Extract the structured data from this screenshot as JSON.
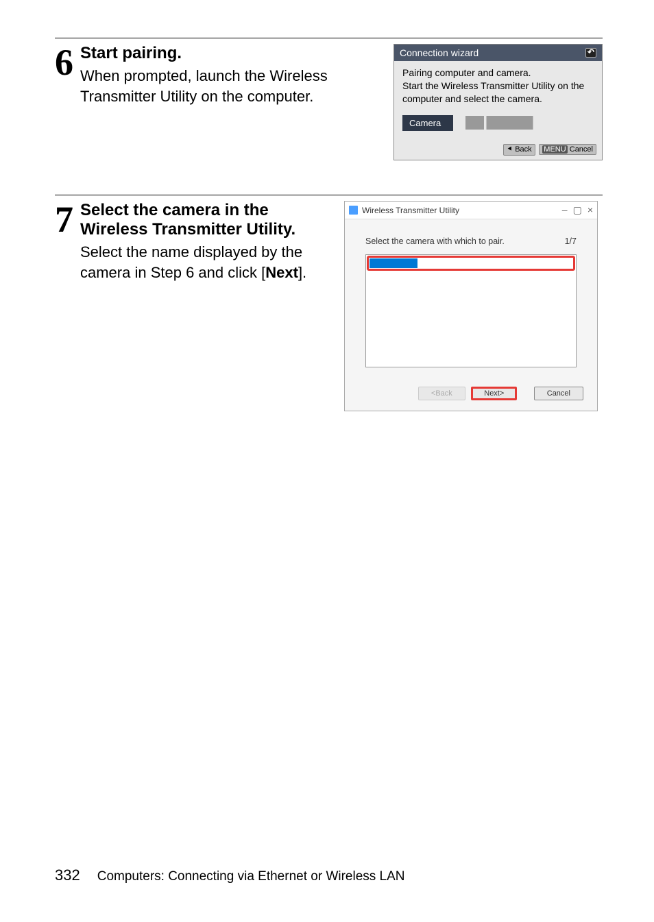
{
  "step6": {
    "number": "6",
    "title": "Start pairing.",
    "text": "When prompted, launch the Wireless Transmitter Utility on the computer."
  },
  "camera": {
    "header": "Connection wizard",
    "body_line1": "Pairing computer and camera.",
    "body_line2": "Start the Wireless Transmitter Utility on the computer and select the camera.",
    "camera_label": "Camera",
    "back_btn": "Back",
    "menu_btn": "MENU",
    "cancel_btn": "Cancel"
  },
  "step7": {
    "number": "7",
    "title": "Select the camera in the Wireless Transmitter Utility.",
    "text_pre": "Select the name displayed by the camera in Step 6 and click [",
    "text_bold": "Next",
    "text_post": "]."
  },
  "dialog": {
    "title": "Wireless Transmitter Utility",
    "prompt": "Select the camera with which to pair.",
    "page": "1/7",
    "back_btn": "<Back",
    "next_btn": "Next>",
    "cancel_btn": "Cancel"
  },
  "footer": {
    "page_number": "332",
    "section": "Computers: Connecting via Ethernet or Wireless LAN"
  }
}
